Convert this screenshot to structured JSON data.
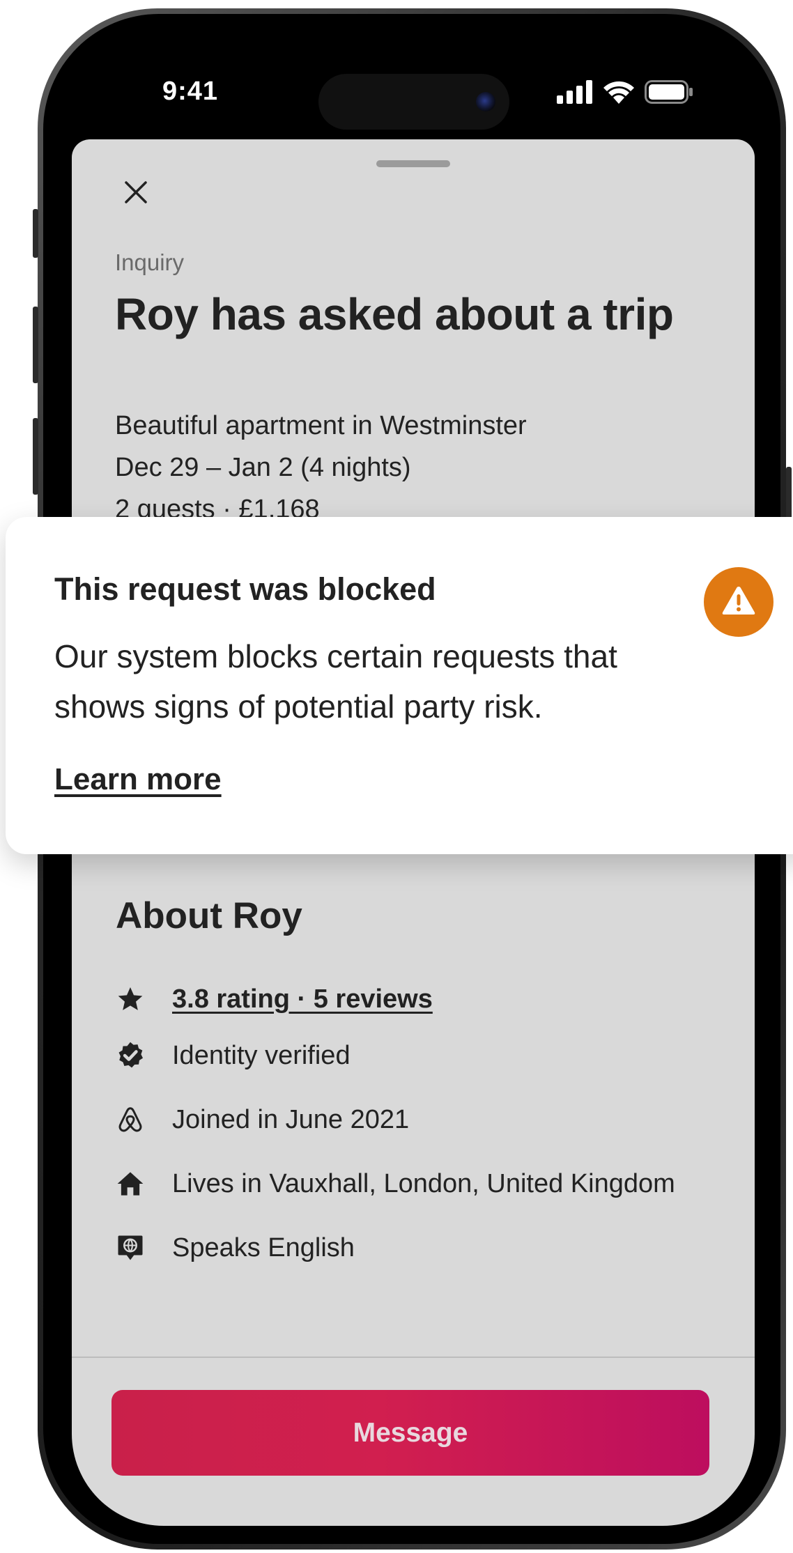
{
  "status_bar": {
    "time": "9:41"
  },
  "sheet": {
    "eyebrow": "Inquiry",
    "title": "Roy has asked about a trip",
    "details": [
      "Beautiful apartment in Westminster",
      "Dec 29 – Jan 2 (4 nights)",
      "2 guests · £1,168"
    ]
  },
  "alert": {
    "title": "This request was blocked",
    "body": "Our system blocks certain requests that shows signs of potential party risk.",
    "link": "Learn more",
    "accent_color": "#E07912",
    "icon": "warning-triangle-icon"
  },
  "about": {
    "title": "About Roy",
    "rating_link": "3.8 rating · 5 reviews",
    "items": [
      {
        "icon": "star-icon",
        "label": "3.8 rating · 5 reviews"
      },
      {
        "icon": "verified-badge-icon",
        "label": "Identity verified"
      },
      {
        "icon": "airbnb-logo-icon",
        "label": "Joined in June 2021"
      },
      {
        "icon": "home-icon",
        "label": "Lives in Vauxhall, London, United Kingdom"
      },
      {
        "icon": "language-globe-icon",
        "label": "Speaks English"
      }
    ]
  },
  "footer": {
    "message_button": "Message",
    "button_colors": [
      "#C9204A",
      "#BD0E5E"
    ]
  }
}
